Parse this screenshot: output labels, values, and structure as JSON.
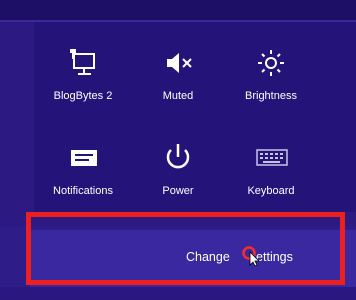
{
  "tiles": [
    {
      "id": "network",
      "label": "BlogBytes  2",
      "icon": "network-monitor-icon"
    },
    {
      "id": "volume",
      "label": "Muted",
      "icon": "speaker-muted-icon"
    },
    {
      "id": "brightness",
      "label": "Brightness",
      "icon": "sun-icon"
    },
    {
      "id": "notifications",
      "label": "Notifications",
      "icon": "notifications-icon"
    },
    {
      "id": "power",
      "label": "Power",
      "icon": "power-icon"
    },
    {
      "id": "keyboard",
      "label": "Keyboard",
      "icon": "keyboard-icon"
    }
  ],
  "change_settings": {
    "prefix": "Change",
    "suffix": "settings"
  },
  "colors": {
    "background": "#2c1a82",
    "highlight": "#ee1f1f",
    "text": "#ffffff",
    "cursor_ring": "#ff2a2a"
  }
}
